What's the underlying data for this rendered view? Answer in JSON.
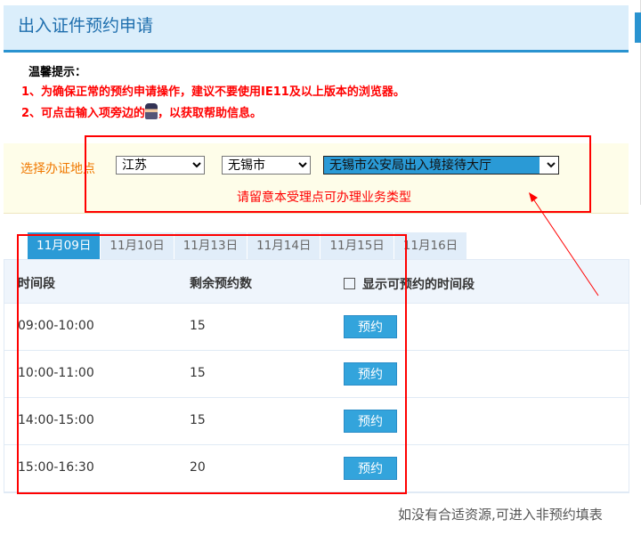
{
  "header": {
    "title": "出入证件预约申请"
  },
  "tips": {
    "heading": "温馨提示：",
    "line1": "1、为确保正常的预约申请操作，建议不要使用IE11及以上版本的浏览器。",
    "line2_a": "2、可点击输入项旁边的",
    "line2_b": "，以获取帮助信息。"
  },
  "location": {
    "label": "选择办证地点",
    "province": "江苏",
    "city": "无锡市",
    "office": "无锡市公安局出入境接待大厅",
    "note": "请留意本受理点可办理业务类型"
  },
  "tabs": [
    {
      "label": "11月09日"
    },
    {
      "label": "11月10日"
    },
    {
      "label": "11月13日"
    },
    {
      "label": "11月14日"
    },
    {
      "label": "11月15日"
    },
    {
      "label": "11月16日"
    }
  ],
  "table": {
    "headers": {
      "time": "时间段",
      "remaining": "剩余预约数",
      "show_available": "显示可预约的时间段"
    },
    "rows": [
      {
        "time": "09:00-10:00",
        "remaining": "15",
        "action": "预约"
      },
      {
        "time": "10:00-11:00",
        "remaining": "15",
        "action": "预约"
      },
      {
        "time": "14:00-15:00",
        "remaining": "15",
        "action": "预约"
      },
      {
        "time": "15:00-16:30",
        "remaining": "20",
        "action": "预约"
      }
    ]
  },
  "footer": {
    "text": "如没有合适资源,可进入非预约填表"
  },
  "colors": {
    "accent": "#2a9ad6",
    "annotation": "#ff0000"
  }
}
